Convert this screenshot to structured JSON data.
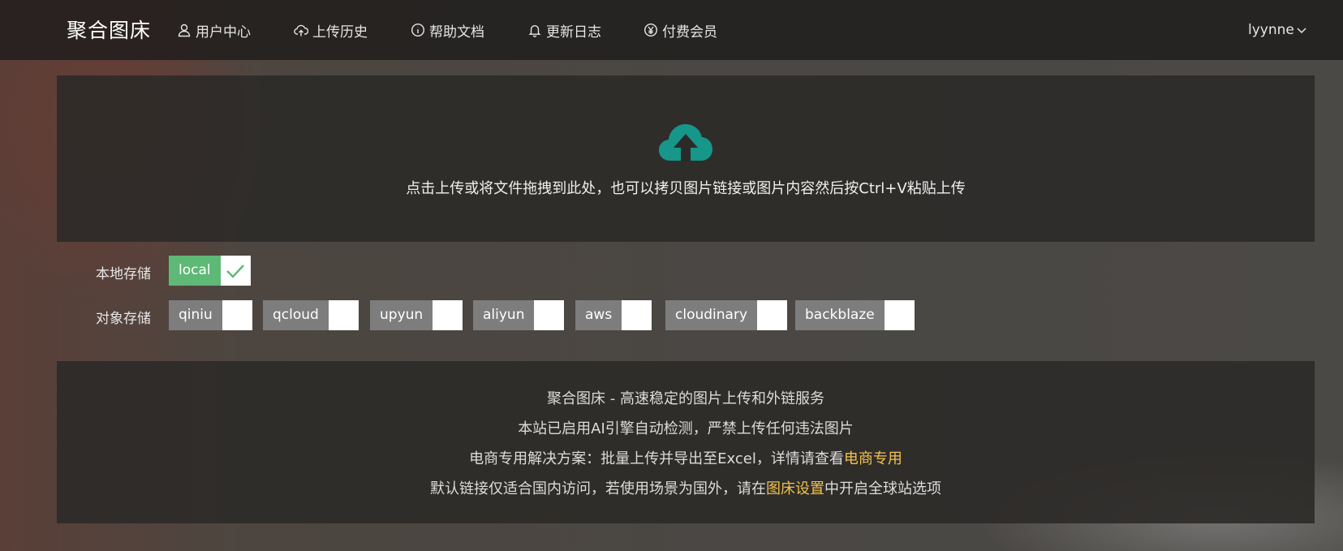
{
  "nav": {
    "logo": "聚合图床",
    "items": [
      {
        "label": "用户中心",
        "icon": "user-icon"
      },
      {
        "label": "上传历史",
        "icon": "cloud-upload-icon"
      },
      {
        "label": "帮助文档",
        "icon": "info-icon"
      },
      {
        "label": "更新日志",
        "icon": "bell-icon"
      },
      {
        "label": "付费会员",
        "icon": "yen-icon"
      }
    ],
    "user": "lyynne"
  },
  "upload": {
    "text": "点击上传或将文件拖拽到此处，也可以拷贝图片链接或图片内容然后按Ctrl+V粘贴上传",
    "icon_color": "#17968a"
  },
  "storage": {
    "local_label": "本地存储",
    "local": [
      {
        "name": "local",
        "checked": true
      }
    ],
    "object_label": "对象存储",
    "object": [
      {
        "name": "qiniu",
        "checked": false
      },
      {
        "name": "qcloud",
        "checked": false
      },
      {
        "name": "upyun",
        "checked": false
      },
      {
        "name": "aliyun",
        "checked": false
      },
      {
        "name": "aws",
        "checked": false
      },
      {
        "name": "cloudinary",
        "checked": false
      },
      {
        "name": "backblaze",
        "checked": false
      }
    ]
  },
  "info": {
    "line1": "聚合图床 - 高速稳定的图片上传和外链服务",
    "line2": "本站已启用AI引擎自动检测，严禁上传任何违法图片",
    "line3_prefix": "电商专用解决方案：批量上传并导出至Excel，详情请查看",
    "line3_link": "电商专用",
    "line4_prefix": "默认链接仅适合国内访问，若使用场景为国外，请在",
    "line4_link": "图床设置",
    "line4_suffix": "中开启全球站选项"
  },
  "colors": {
    "accent_green": "#5eb876",
    "link_yellow": "#f2c14e",
    "teal": "#17968a"
  }
}
